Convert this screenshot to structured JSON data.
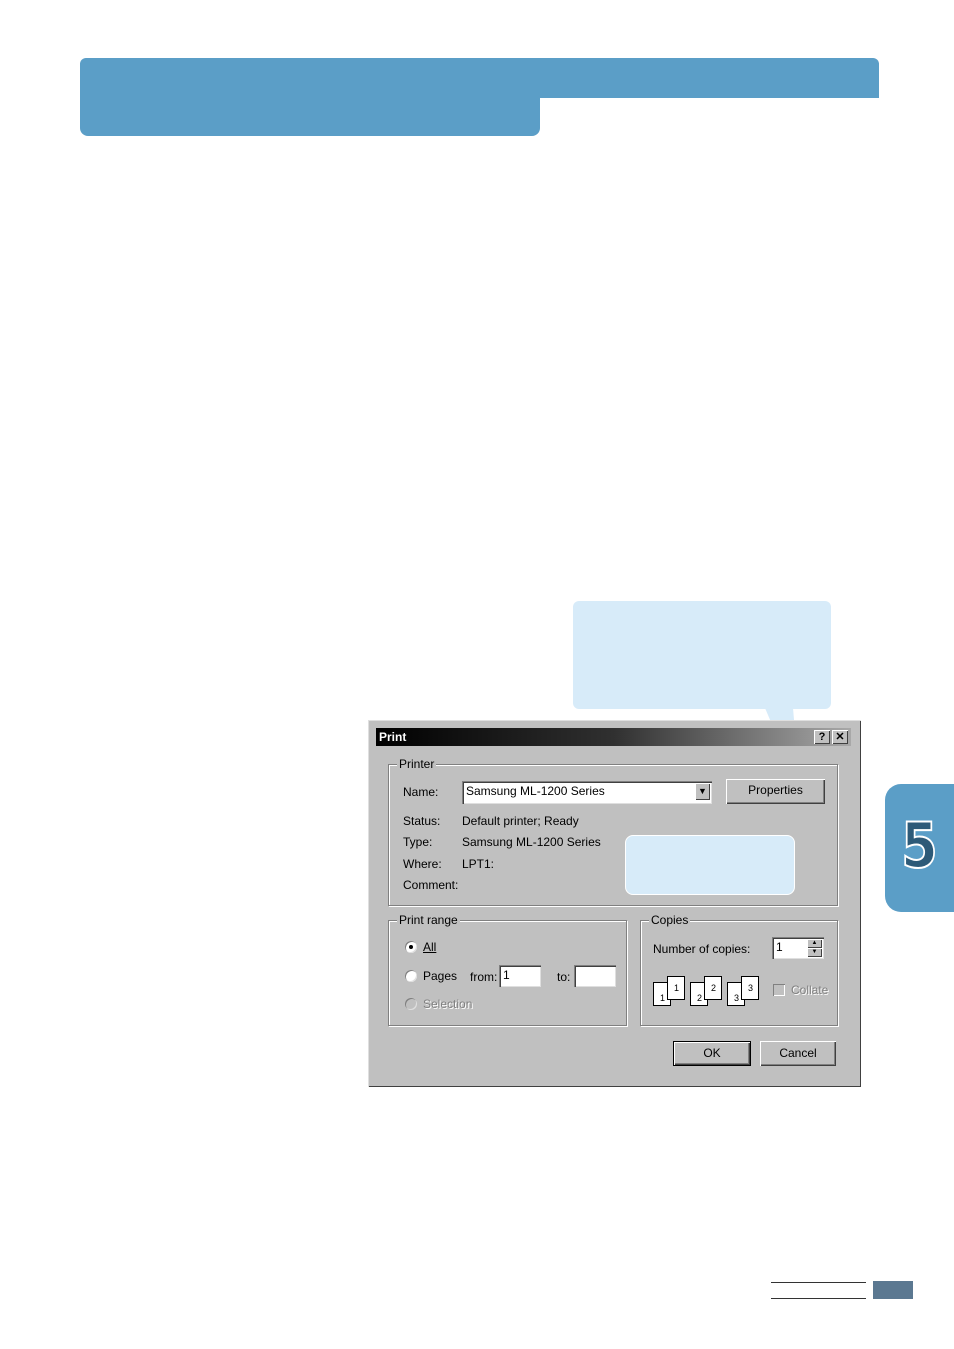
{
  "chapter": {
    "number": "5"
  },
  "dialog": {
    "title": "Print",
    "help_button": "?",
    "close_button": "✕",
    "printer_group": {
      "label": "Printer",
      "name_label": "Name:",
      "name_value": "Samsung ML-1200 Series",
      "properties_button": "Properties",
      "status_label": "Status:",
      "status_value": "Default printer; Ready",
      "type_label": "Type:",
      "type_value": "Samsung ML-1200 Series",
      "where_label": "Where:",
      "where_value": "LPT1:",
      "comment_label": "Comment:"
    },
    "print_range": {
      "label": "Print range",
      "all_label": "All",
      "pages_label": "Pages",
      "from_label": "from:",
      "from_value": "1",
      "to_label": "to:",
      "to_value": "",
      "selection_label": "Selection",
      "selected": "All"
    },
    "copies": {
      "label": "Copies",
      "number_label": "Number of copies:",
      "number_value": "1",
      "collate_label": "Collate",
      "pages": [
        "1",
        "1",
        "2",
        "2",
        "3",
        "3"
      ]
    },
    "ok_button": "OK",
    "cancel_button": "Cancel"
  },
  "colors": {
    "accent": "#5b9ec7",
    "callout": "#d7ebf9",
    "footer": "#5b7891"
  }
}
